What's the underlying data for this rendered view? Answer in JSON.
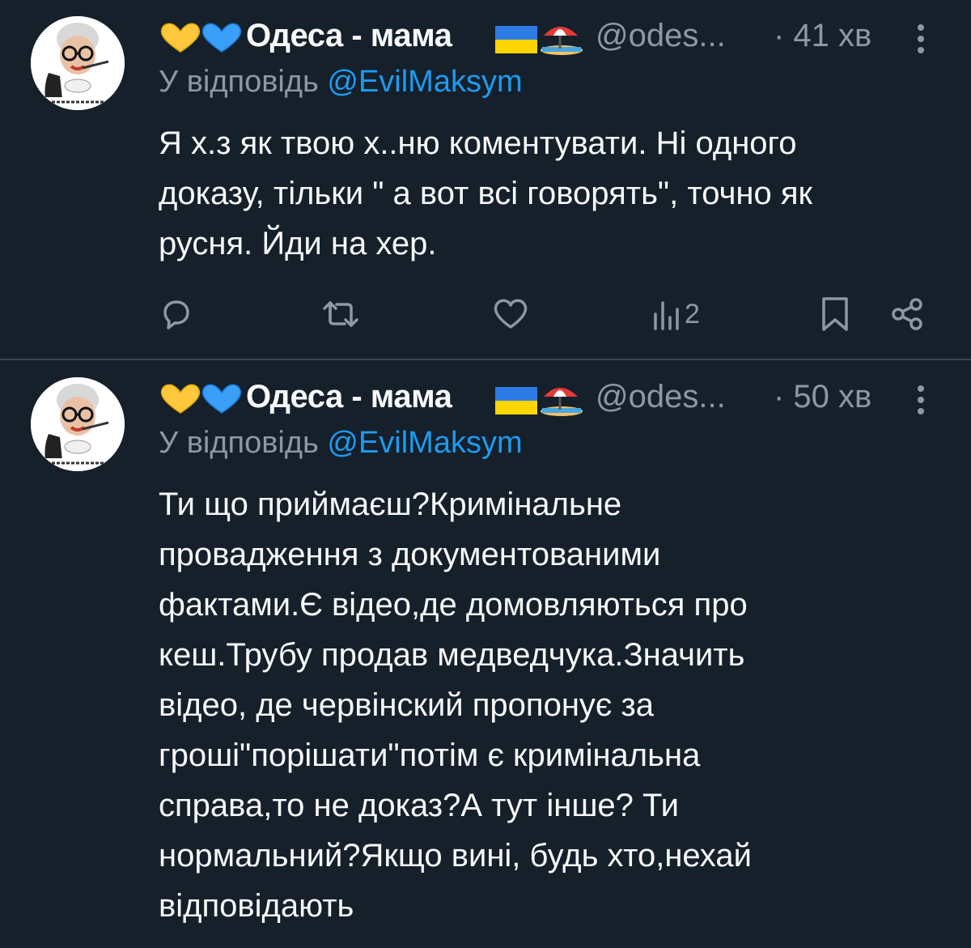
{
  "colors": {
    "background": "#15202b",
    "text": "#f7f9f9",
    "muted": "#8b98a5",
    "link": "#1d9bf0",
    "divider": "#38444d"
  },
  "tweets": [
    {
      "author": {
        "display_name": "Одеса - мама",
        "handle": "@odes...",
        "avatar_icon": "avatar-lady-with-glasses-icon",
        "emoji_prefix": [
          "yellow-heart-icon",
          "blue-heart-icon"
        ],
        "emoji_suffix": [
          "ukraine-flag-icon",
          "beach-umbrella-icon"
        ]
      },
      "time": "· 41 хв",
      "reply_prefix": "У відповідь ",
      "reply_to": "@EvilMaksym",
      "text": "Я х.з як твою х..ню коментувати. Ні одного\nдоказу, тільки \" а вот всі говорять\", точно як\nрусня. Йди на хер.",
      "actions": {
        "reply_icon": "reply-icon",
        "retweet_icon": "retweet-icon",
        "like_icon": "heart-icon",
        "views_icon": "views-icon",
        "views_count": "2",
        "bookmark_icon": "bookmark-icon",
        "share_icon": "share-icon"
      }
    },
    {
      "author": {
        "display_name": "Одеса - мама",
        "handle": "@odes...",
        "avatar_icon": "avatar-lady-with-glasses-icon",
        "emoji_prefix": [
          "yellow-heart-icon",
          "blue-heart-icon"
        ],
        "emoji_suffix": [
          "ukraine-flag-icon",
          "beach-umbrella-icon"
        ]
      },
      "time": "· 50 хв",
      "reply_prefix": "У відповідь ",
      "reply_to": "@EvilMaksym",
      "text": "Ти що приймаєш?Кримінальне\nпровадження з документованими\nфактами.Є відео,де домовляються про\nкеш.Трубу продав медведчука.Значить\nвідео, де червінский пропонує за\nгроші\"порішати\"потім є кримінальна\nсправа,то не доказ?А тут інше? Ти\nнормальний?Якщо вині, будь хто,нехай\nвідповідають"
    }
  ]
}
